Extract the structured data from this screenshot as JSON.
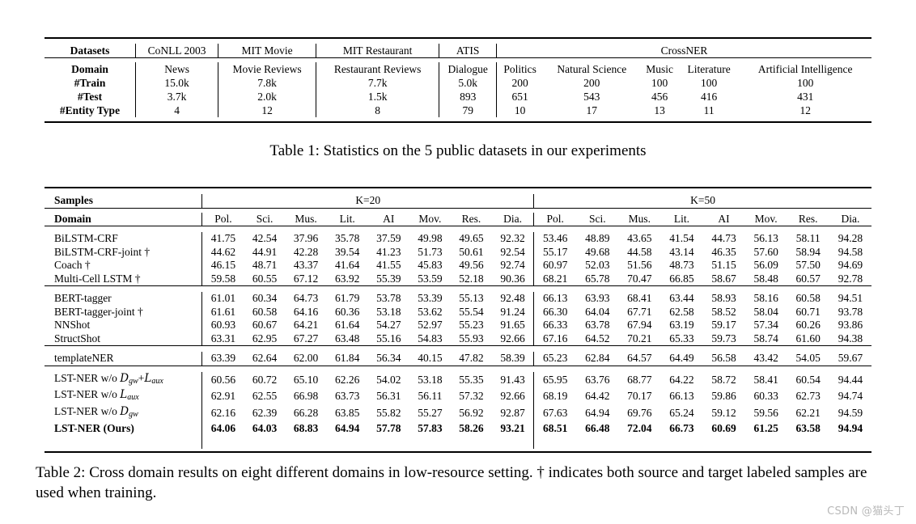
{
  "table1": {
    "header_row": {
      "label": "Datasets",
      "groups": [
        "CoNLL 2003",
        "MIT Movie",
        "MIT Restaurant",
        "ATIS",
        "CrossNER"
      ]
    },
    "row_labels": [
      "Domain",
      "#Train",
      "#Test",
      "#Entity Type"
    ],
    "columns": [
      {
        "name": "CoNLL 2003",
        "domain": "News",
        "train": "15.0k",
        "test": "3.7k",
        "entity_type": "4"
      },
      {
        "name": "MIT Movie",
        "domain": "Movie Reviews",
        "train": "7.8k",
        "test": "2.0k",
        "entity_type": "12"
      },
      {
        "name": "MIT Restaurant",
        "domain": "Restaurant Reviews",
        "train": "7.7k",
        "test": "1.5k",
        "entity_type": "8"
      },
      {
        "name": "ATIS",
        "domain": "Dialogue",
        "train": "5.0k",
        "test": "893",
        "entity_type": "79"
      },
      {
        "name": "CrossNER-Politics",
        "domain": "Politics",
        "train": "200",
        "test": "651",
        "entity_type": "10"
      },
      {
        "name": "CrossNER-NaturalScience",
        "domain": "Natural Science",
        "train": "200",
        "test": "543",
        "entity_type": "17"
      },
      {
        "name": "CrossNER-Music",
        "domain": "Music",
        "train": "100",
        "test": "456",
        "entity_type": "13"
      },
      {
        "name": "CrossNER-Literature",
        "domain": "Literature",
        "train": "100",
        "test": "416",
        "entity_type": "11"
      },
      {
        "name": "CrossNER-ArtificialIntelligence",
        "domain": "Artificial Intelligence",
        "train": "100",
        "test": "431",
        "entity_type": "12"
      }
    ],
    "caption": "Table 1: Statistics on the 5 public datasets in our experiments"
  },
  "table2": {
    "samples_label": "Samples",
    "domain_label": "Domain",
    "k_groups": [
      "K=20",
      "K=50"
    ],
    "domain_headers": [
      "Pol.",
      "Sci.",
      "Mus.",
      "Lit.",
      "AI",
      "Mov.",
      "Res.",
      "Dia."
    ],
    "rows": [
      {
        "label": "BiLSTM-CRF",
        "dagger": false,
        "bold": false,
        "k20": [
          "41.75",
          "42.54",
          "37.96",
          "35.78",
          "37.59",
          "49.98",
          "49.65",
          "92.32"
        ],
        "k50": [
          "53.46",
          "48.89",
          "43.65",
          "41.54",
          "44.73",
          "56.13",
          "58.11",
          "94.28"
        ]
      },
      {
        "label": "BiLSTM-CRF-joint",
        "dagger": true,
        "bold": false,
        "k20": [
          "44.62",
          "44.91",
          "42.28",
          "39.54",
          "41.23",
          "51.73",
          "50.61",
          "92.54"
        ],
        "k50": [
          "55.17",
          "49.68",
          "44.58",
          "43.14",
          "46.35",
          "57.60",
          "58.94",
          "94.58"
        ]
      },
      {
        "label": "Coach",
        "dagger": true,
        "bold": false,
        "k20": [
          "46.15",
          "48.71",
          "43.37",
          "41.64",
          "41.55",
          "45.83",
          "49.56",
          "92.74"
        ],
        "k50": [
          "60.97",
          "52.03",
          "51.56",
          "48.73",
          "51.15",
          "56.09",
          "57.50",
          "94.69"
        ]
      },
      {
        "label": "Multi-Cell LSTM",
        "dagger": true,
        "bold": false,
        "k20": [
          "59.58",
          "60.55",
          "67.12",
          "63.92",
          "55.39",
          "53.59",
          "52.18",
          "90.36"
        ],
        "k50": [
          "68.21",
          "65.78",
          "70.47",
          "66.85",
          "58.67",
          "58.48",
          "60.57",
          "92.78"
        ]
      },
      {
        "label": "BERT-tagger",
        "dagger": false,
        "bold": false,
        "k20": [
          "61.01",
          "60.34",
          "64.73",
          "61.79",
          "53.78",
          "53.39",
          "55.13",
          "92.48"
        ],
        "k50": [
          "66.13",
          "63.93",
          "68.41",
          "63.44",
          "58.93",
          "58.16",
          "60.58",
          "94.51"
        ]
      },
      {
        "label": "BERT-tagger-joint",
        "dagger": true,
        "bold": false,
        "k20": [
          "61.61",
          "60.58",
          "64.16",
          "60.36",
          "53.18",
          "53.62",
          "55.54",
          "91.24"
        ],
        "k50": [
          "66.30",
          "64.04",
          "67.71",
          "62.58",
          "58.52",
          "58.04",
          "60.71",
          "93.78"
        ]
      },
      {
        "label": "NNShot",
        "dagger": false,
        "bold": false,
        "k20": [
          "60.93",
          "60.67",
          "64.21",
          "61.64",
          "54.27",
          "52.97",
          "55.23",
          "91.65"
        ],
        "k50": [
          "66.33",
          "63.78",
          "67.94",
          "63.19",
          "59.17",
          "57.34",
          "60.26",
          "93.86"
        ]
      },
      {
        "label": "StructShot",
        "dagger": false,
        "bold": false,
        "k20": [
          "63.31",
          "62.95",
          "67.27",
          "63.48",
          "55.16",
          "54.83",
          "55.93",
          "92.66"
        ],
        "k50": [
          "67.16",
          "64.52",
          "70.21",
          "65.33",
          "59.73",
          "58.74",
          "61.60",
          "94.38"
        ]
      },
      {
        "label": "templateNER",
        "dagger": false,
        "bold": false,
        "k20": [
          "63.39",
          "62.64",
          "62.00",
          "61.84",
          "56.34",
          "40.15",
          "47.82",
          "58.39"
        ],
        "k50": [
          "65.23",
          "62.84",
          "64.57",
          "64.49",
          "56.58",
          "43.42",
          "54.05",
          "59.67"
        ]
      },
      {
        "label": "LST-NER w/o Dgw+Laux",
        "dagger": false,
        "bold": false,
        "k20": [
          "60.56",
          "60.72",
          "65.10",
          "62.26",
          "54.02",
          "53.18",
          "55.35",
          "91.43"
        ],
        "k50": [
          "65.95",
          "63.76",
          "68.77",
          "64.22",
          "58.72",
          "58.41",
          "60.54",
          "94.44"
        ]
      },
      {
        "label": "LST-NER w/o Laux",
        "dagger": false,
        "bold": false,
        "k20": [
          "62.91",
          "62.55",
          "66.98",
          "63.73",
          "56.31",
          "56.11",
          "57.32",
          "92.66"
        ],
        "k50": [
          "68.19",
          "64.42",
          "70.17",
          "66.13",
          "59.86",
          "60.33",
          "62.73",
          "94.74"
        ]
      },
      {
        "label": "LST-NER w/o Dgw",
        "dagger": false,
        "bold": false,
        "k20": [
          "62.16",
          "62.39",
          "66.28",
          "63.85",
          "55.82",
          "55.27",
          "56.92",
          "92.87"
        ],
        "k50": [
          "67.63",
          "64.94",
          "69.76",
          "65.24",
          "59.12",
          "59.56",
          "62.21",
          "94.59"
        ]
      },
      {
        "label": "LST-NER (Ours)",
        "dagger": false,
        "bold": true,
        "k20": [
          "64.06",
          "64.03",
          "68.83",
          "64.94",
          "57.78",
          "57.83",
          "58.26",
          "93.21"
        ],
        "k50": [
          "68.51",
          "66.48",
          "72.04",
          "66.73",
          "60.69",
          "61.25",
          "63.58",
          "94.94"
        ]
      }
    ],
    "caption": "Table 2: Cross domain results on eight different domains in low-resource setting. † indicates both source and target labeled samples are used when training."
  },
  "watermark": "CSDN @猫头丁"
}
